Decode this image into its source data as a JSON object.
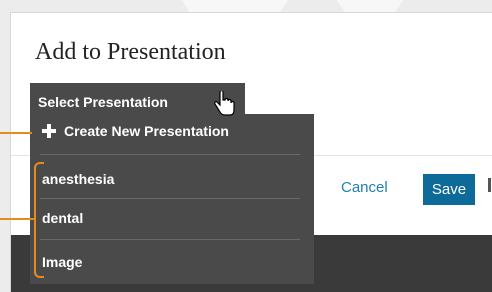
{
  "dialog": {
    "title": "Add to Presentation",
    "cancel_label": "Cancel",
    "save_label": "Save"
  },
  "dropdown": {
    "button_label": "Select Presentation",
    "create_label": "Create New Presentation",
    "items": [
      "anesthesia",
      "dental",
      "Image"
    ]
  },
  "colors": {
    "menu_bg": "#4a4a4a",
    "save_bg": "#0e6a99",
    "link": "#1f7fb6",
    "annotation": "#e58a1f",
    "footer": "#3a3a3a"
  },
  "icons": [
    "plus-icon",
    "hand-pointer-icon"
  ]
}
